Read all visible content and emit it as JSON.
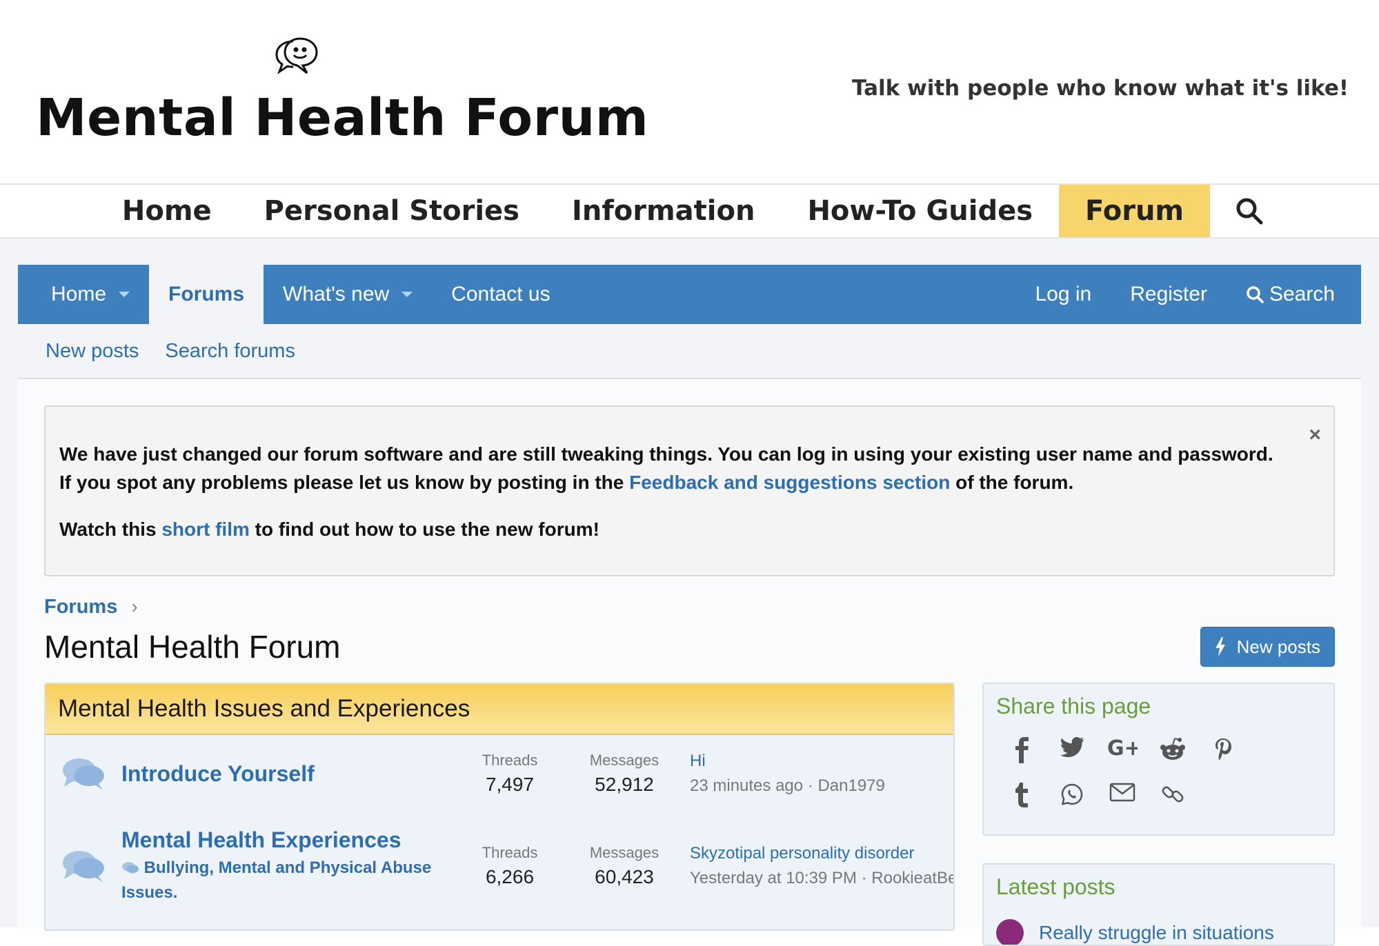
{
  "header": {
    "logo_text": "Mental Health Forum",
    "tagline": "Talk with people who know what it's like!"
  },
  "site_nav": {
    "items": [
      "Home",
      "Personal Stories",
      "Information",
      "How-To Guides",
      "Forum"
    ],
    "active": "Forum"
  },
  "forum_nav": {
    "home": "Home",
    "forums": "Forums",
    "whats_new": "What's new",
    "contact": "Contact us",
    "login": "Log in",
    "register": "Register",
    "search": "Search"
  },
  "sub_nav": {
    "new_posts": "New posts",
    "search_forums": "Search forums"
  },
  "notice": {
    "line1": "We have just changed our forum software and are still tweaking things. You can log in using your existing user name and password.",
    "line2_pre": "If you spot any problems please let us know by posting in the ",
    "line2_link": "Feedback and suggestions section",
    "line2_post": " of the forum.",
    "line3_pre": "Watch this ",
    "line3_link": "short film",
    "line3_post": " to find out how to use the new forum!",
    "close": "×"
  },
  "breadcrumb": {
    "root": "Forums",
    "chevron": "›"
  },
  "page": {
    "title": "Mental Health Forum",
    "new_posts_button": "New posts"
  },
  "category": {
    "title": "Mental Health Issues and Experiences",
    "nodes": [
      {
        "name": "Introduce Yourself",
        "sub": "",
        "threads_label": "Threads",
        "threads": "7,497",
        "messages_label": "Messages",
        "messages": "52,912",
        "last_title": "Hi",
        "last_meta": "23 minutes ago · Dan1979"
      },
      {
        "name": "Mental Health Experiences",
        "sub": "Bullying, Mental and Physical Abuse Issues.",
        "threads_label": "Threads",
        "threads": "6,266",
        "messages_label": "Messages",
        "messages": "60,423",
        "last_title": "Skyzotipal personality disorder",
        "last_meta": "Yesterday at 10:39 PM · RookieatBe"
      }
    ]
  },
  "sidebar": {
    "share_title": "Share this page",
    "share_icons": [
      "facebook-icon",
      "twitter-icon",
      "google-plus-icon",
      "reddit-icon",
      "pinterest-icon",
      "tumblr-icon",
      "whatsapp-icon",
      "email-icon",
      "link-icon"
    ],
    "latest_title": "Latest posts",
    "latest_first": "Really struggle in situations"
  },
  "colors": {
    "nav_blue": "#3e7fbe",
    "link_blue": "#2e6db0",
    "forum_yellow": "#f8d56b",
    "sidebar_green": "#6a9d3c"
  }
}
